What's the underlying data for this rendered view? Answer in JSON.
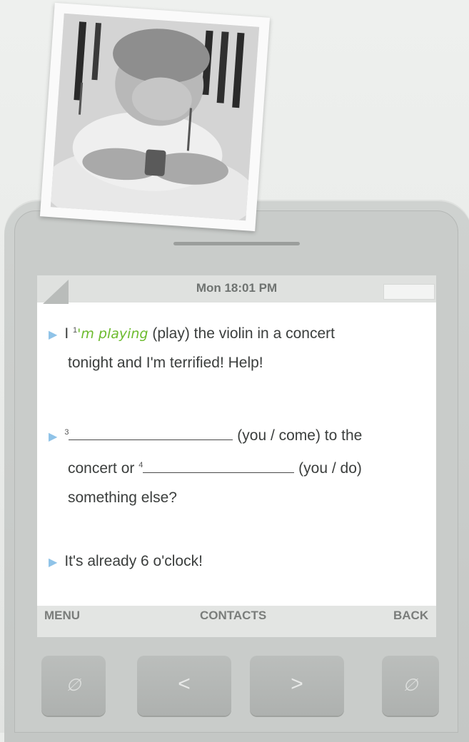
{
  "status": {
    "time": "Mon 18:01 PM"
  },
  "messages": [
    {
      "prefix": "I ",
      "num": "1",
      "answer": "'m playing",
      "rest": " (play) the violin in a concert",
      "line2": "tonight and I'm terrified! Help!"
    },
    {
      "num3": "3",
      "line1_rest": " (you / come) to the",
      "line2_pre": "concert or ",
      "num4": "4",
      "line2_rest": " (you / do)",
      "line3": "something else?"
    },
    {
      "text": "It's already 6 o'clock!"
    }
  ],
  "softkeys": {
    "left": "MENU",
    "center": "CONTACTS",
    "right": "BACK"
  },
  "keys": {
    "left": "<",
    "right": ">"
  },
  "icons": {
    "arrow": "play-arrow-icon",
    "left_key": "phone-slash-icon",
    "right_key": "phone-slash-icon"
  },
  "colors": {
    "answer": "#6cbb2e",
    "arrow": "#8fc3e8",
    "screen": "#ffffff"
  }
}
